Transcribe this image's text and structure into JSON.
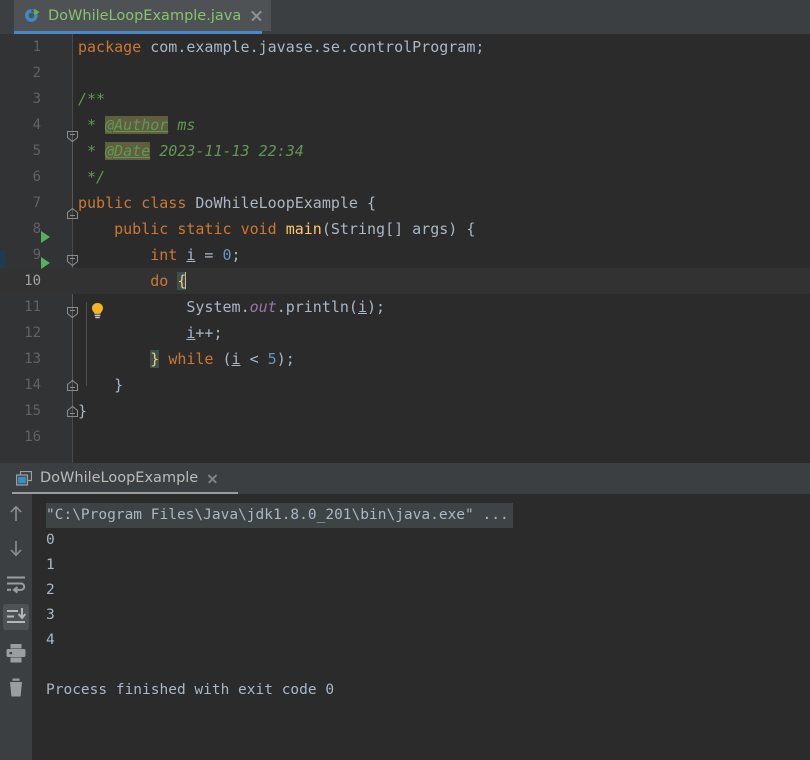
{
  "window": {
    "background_color": "#3c3f41",
    "editor_background": "#2b2b2b",
    "gutter_background": "#313335",
    "accent_color": "#4a88c7"
  },
  "editor_tab": {
    "label": "DoWhileLoopExample.java",
    "icon": "java-class-icon",
    "close_icon": "close-icon",
    "active": true,
    "label_color": "#86c56b"
  },
  "editor": {
    "current_line": 10,
    "caret_line": 10,
    "lines": [
      {
        "n": "1",
        "text": "package com.example.javase.se.controlProgram;"
      },
      {
        "n": "2",
        "text": ""
      },
      {
        "n": "3",
        "text": "/**"
      },
      {
        "n": "4",
        "text": " * @Author ms"
      },
      {
        "n": "5",
        "text": " * @Date 2023-11-13 22:34"
      },
      {
        "n": "6",
        "text": " */"
      },
      {
        "n": "7",
        "text": "public class DoWhileLoopExample {"
      },
      {
        "n": "8",
        "text": "    public static void main(String[] args) {"
      },
      {
        "n": "9",
        "text": "        int i = 0;"
      },
      {
        "n": "10",
        "text": "        do {"
      },
      {
        "n": "11",
        "text": "            System.out.println(i);"
      },
      {
        "n": "12",
        "text": "            i++;"
      },
      {
        "n": "13",
        "text": "        } while (i < 5);"
      },
      {
        "n": "14",
        "text": "    }"
      },
      {
        "n": "15",
        "text": "}"
      },
      {
        "n": "16",
        "text": ""
      }
    ],
    "gutter_icons": {
      "run_class_line": "7",
      "run_method_line": "8",
      "intention_bulb_line": "10",
      "run_icon": "run-triangle-icon",
      "bulb_icon": "lightbulb-icon",
      "fold_icon": "fold-marker-icon"
    },
    "javadoc_tags": [
      "@Author",
      "@Date"
    ],
    "javadoc_author": "ms",
    "javadoc_date": "2023-11-13 22:34"
  },
  "console_tab": {
    "label": "DoWhileLoopExample",
    "icon": "console-window-icon",
    "close_icon": "close-icon",
    "active": true
  },
  "console_toolbar": {
    "buttons": [
      {
        "name": "up-arrow-icon",
        "tooltip": "Up the Stack Trace",
        "active": false
      },
      {
        "name": "down-arrow-icon",
        "tooltip": "Down the Stack Trace",
        "active": false
      },
      {
        "name": "soft-wrap-icon",
        "tooltip": "Soft-Wrap",
        "active": false
      },
      {
        "name": "scroll-to-end-icon",
        "tooltip": "Scroll to End",
        "active": true
      },
      {
        "name": "print-icon",
        "tooltip": "Print",
        "active": false
      },
      {
        "name": "trash-icon",
        "tooltip": "Clear All",
        "active": false
      }
    ]
  },
  "console_output": {
    "lines": [
      {
        "text": "\"C:\\Program Files\\Java\\jdk1.8.0_201\\bin\\java.exe\" ...",
        "selected": true
      },
      {
        "text": "0",
        "selected": false
      },
      {
        "text": "1",
        "selected": false
      },
      {
        "text": "2",
        "selected": false
      },
      {
        "text": "3",
        "selected": false
      },
      {
        "text": "4",
        "selected": false
      },
      {
        "text": "",
        "selected": false
      },
      {
        "text": "Process finished with exit code 0",
        "selected": false
      }
    ]
  }
}
